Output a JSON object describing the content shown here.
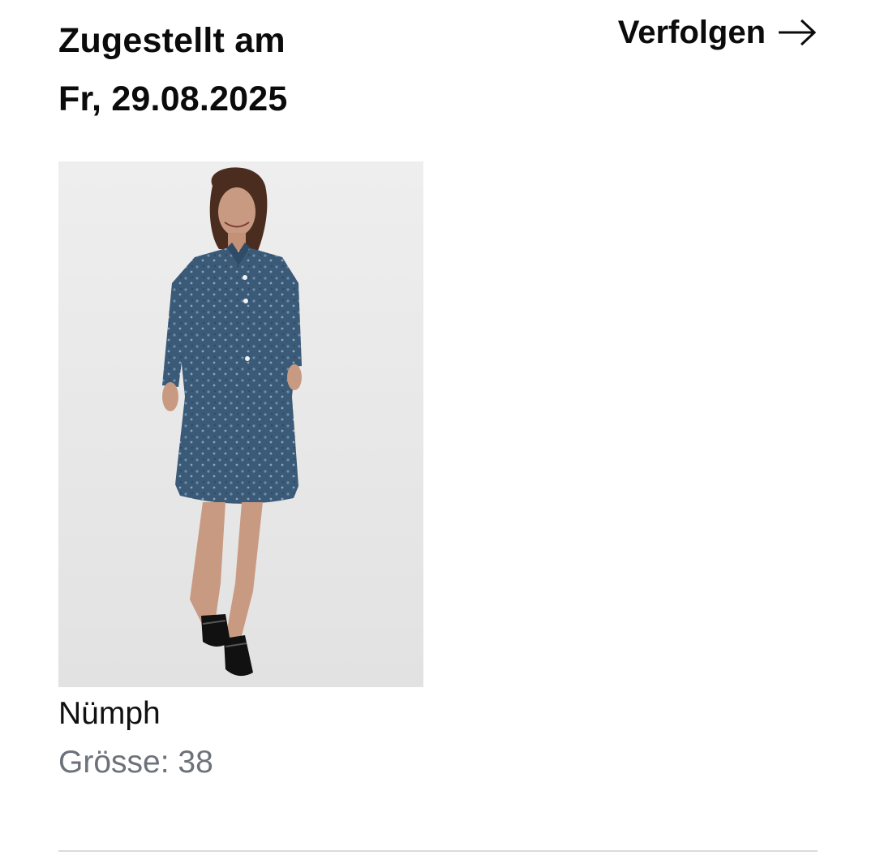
{
  "delivery": {
    "status_label": "Zugestellt am",
    "date": "Fr, 29.08.2025"
  },
  "tracking": {
    "link_label": "Verfolgen",
    "icon": "arrow-right-icon"
  },
  "item": {
    "image_icon": "product-photo",
    "brand": "Nümph",
    "size_text": "Grösse: 38"
  },
  "colors": {
    "text_primary": "#0b0b0b",
    "text_secondary": "#6c717a",
    "divider": "#d9dcdf",
    "image_background": "#e6e6e6",
    "dress_denim": "#3a5a78"
  }
}
